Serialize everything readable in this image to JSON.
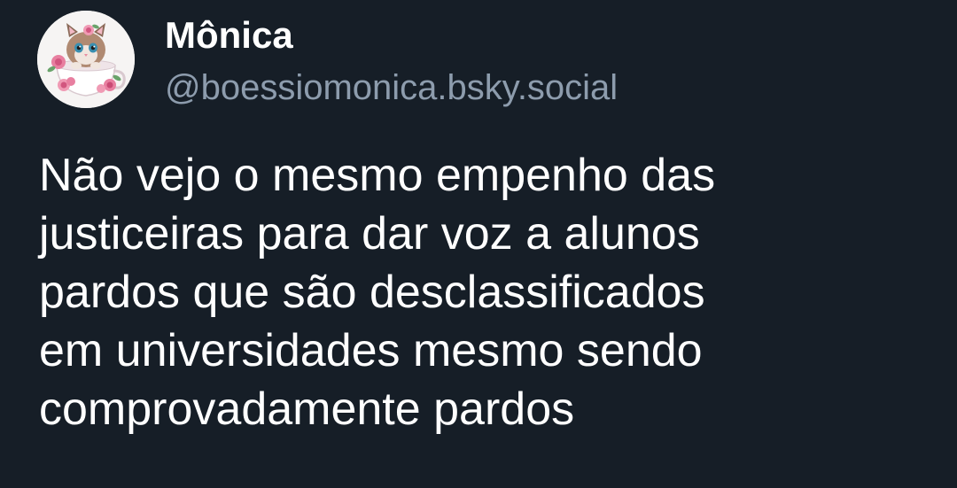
{
  "author": {
    "display_name": "Mônica",
    "handle": "@boessiomonica.bsky.social",
    "avatar_icon": "kitten-in-teacup-with-roses-icon"
  },
  "post": {
    "lines": [
      "Não vejo o mesmo empenho das",
      "justiceiras para dar voz a alunos",
      "pardos que são desclassificados",
      "em universidades mesmo sendo",
      "comprovadamente pardos"
    ]
  },
  "colors": {
    "background": "#161e27",
    "text_primary": "#ffffff",
    "text_secondary": "#8d9cad"
  }
}
